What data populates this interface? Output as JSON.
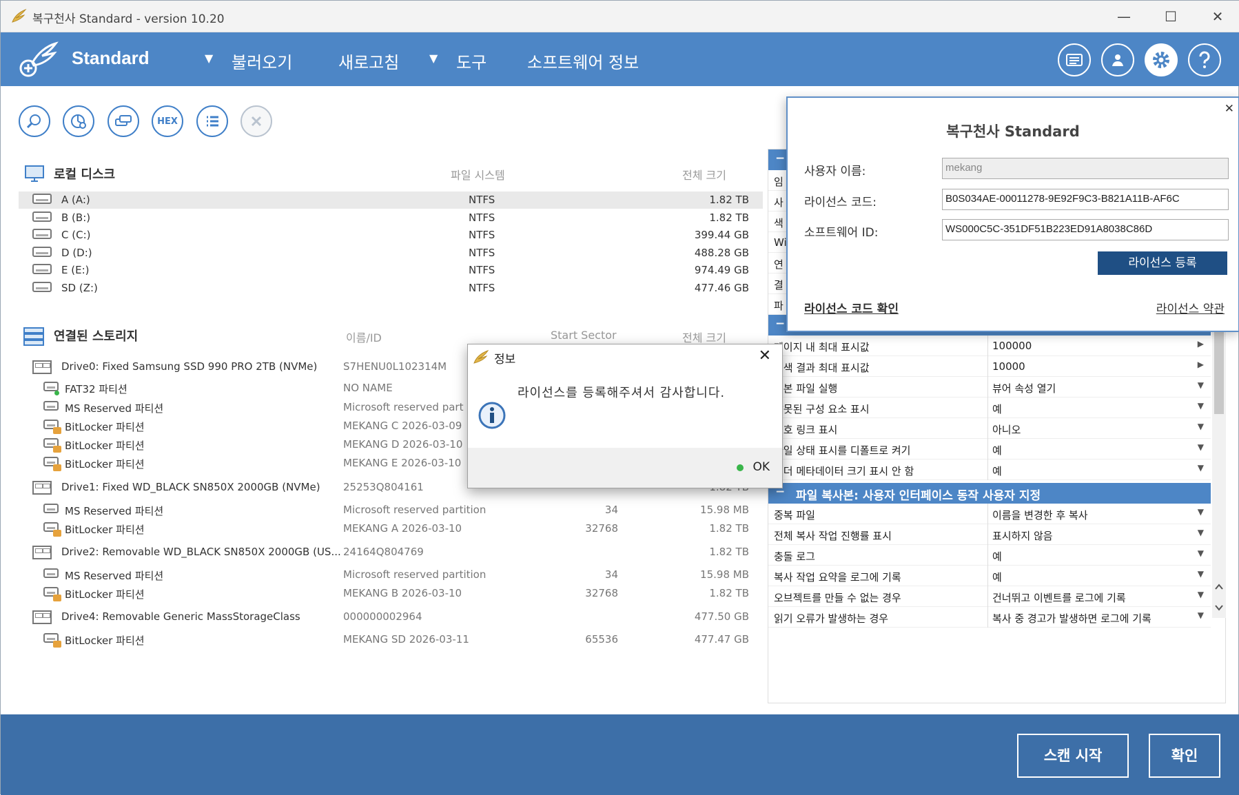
{
  "window": {
    "title": "복구천사 Standard - version 10.20",
    "minimize": "—",
    "maximize": "☐",
    "close": "✕"
  },
  "header": {
    "brand": "Standard",
    "menu": {
      "open": "불러오기",
      "refresh": "새로고침",
      "tools": "도구",
      "about": "소프트웨어 정보"
    },
    "caret": "▼"
  },
  "toolbar": {
    "hex_label": "HEX"
  },
  "local_disk": {
    "title": "로컬 디스크",
    "col_fs": "파일 시스템",
    "col_size": "전체 크기",
    "rows": [
      {
        "name": "A (A:)",
        "fs": "NTFS",
        "size": "1.82 TB"
      },
      {
        "name": "B (B:)",
        "fs": "NTFS",
        "size": "1.82 TB"
      },
      {
        "name": "C (C:)",
        "fs": "NTFS",
        "size": "399.44 GB"
      },
      {
        "name": "D (D:)",
        "fs": "NTFS",
        "size": "488.28 GB"
      },
      {
        "name": "E (E:)",
        "fs": "NTFS",
        "size": "974.49 GB"
      },
      {
        "name": "SD (Z:)",
        "fs": "NTFS",
        "size": "477.46 GB"
      }
    ]
  },
  "storage": {
    "title": "연결된 스토리지",
    "col_id": "이름/ID",
    "col_sector": "Start Sector",
    "col_size": "전체 크기",
    "rows": [
      {
        "name": "Drive0: Fixed Samsung SSD 990 PRO 2TB (NVMe)",
        "id": "S7HENU0L102314M",
        "sector": "",
        "size": ""
      },
      {
        "name": "FAT32 파티션",
        "id": "NO NAME",
        "sector": "",
        "size": ""
      },
      {
        "name": "MS Reserved 파티션",
        "id": "Microsoft reserved part",
        "sector": "",
        "size": ""
      },
      {
        "name": "BitLocker 파티션",
        "id": "MEKANG C 2026-03-09",
        "sector": "",
        "size": ""
      },
      {
        "name": "BitLocker 파티션",
        "id": "MEKANG D 2026-03-10",
        "sector": "",
        "size": ""
      },
      {
        "name": "BitLocker 파티션",
        "id": "MEKANG E 2026-03-10",
        "sector": "",
        "size": ""
      },
      {
        "name": "Drive1: Fixed WD_BLACK SN850X 2000GB (NVMe)",
        "id": "25253Q804161",
        "sector": "",
        "size": "1.82 TB"
      },
      {
        "name": "MS Reserved 파티션",
        "id": "Microsoft reserved partition",
        "sector": "34",
        "size": "15.98 MB"
      },
      {
        "name": "BitLocker 파티션",
        "id": "MEKANG A 2026-03-10",
        "sector": "32768",
        "size": "1.82 TB"
      },
      {
        "name": "Drive2: Removable WD_BLACK SN850X 2000GB (US...",
        "id": "24164Q804769",
        "sector": "",
        "size": "1.82 TB"
      },
      {
        "name": "MS Reserved 파티션",
        "id": "Microsoft reserved partition",
        "sector": "34",
        "size": "15.98 MB"
      },
      {
        "name": "BitLocker 파티션",
        "id": "MEKANG B 2026-03-10",
        "sector": "32768",
        "size": "1.82 TB"
      },
      {
        "name": "Drive4: Removable Generic MassStorageClass",
        "id": "000000002964",
        "sector": "",
        "size": "477.50 GB"
      },
      {
        "name": "BitLocker 파티션",
        "id": "MEKANG SD 2026-03-11",
        "sector": "65536",
        "size": "477.47 GB"
      }
    ]
  },
  "right_panel": {
    "top_rows": [
      "임",
      "사",
      "색",
      "Wi",
      "연",
      "결",
      "파"
    ],
    "dash": "−",
    "rows_a": [
      {
        "k": "페이지 내 최대 표시값",
        "v": "100000",
        "arrow": "▶"
      },
      {
        "k": "검색 결과 최대 표시값",
        "v": "10000",
        "arrow": "▶"
      },
      {
        "k": "원본 파일 실행",
        "v": "뷰어 속성 열기",
        "arrow": "▼"
      },
      {
        "k": "잘못된 구성 요소 표시",
        "v": "예",
        "arrow": "▼"
      },
      {
        "k": "기호 링크 표시",
        "v": "아니오",
        "arrow": "▼"
      },
      {
        "k": "파일 상태 표시를 디폴트로 켜기",
        "v": "예",
        "arrow": "▼"
      },
      {
        "k": "폴더 메타데이터 크기 표시 안 함",
        "v": "예",
        "arrow": "▼"
      }
    ],
    "section": "파일 복사본: 사용자 인터페이스 동작 사용자 지정",
    "rows_b": [
      {
        "k": "중복 파일",
        "v": "이름을 변경한 후 복사",
        "arrow": "▼"
      },
      {
        "k": "전체 복사 작업 진행률 표시",
        "v": "표시하지 않음",
        "arrow": "▼"
      },
      {
        "k": "충돌 로그",
        "v": "예",
        "arrow": "▼"
      },
      {
        "k": "복사 작업 요약을 로그에 기록",
        "v": "예",
        "arrow": "▼"
      },
      {
        "k": "오브젝트를 만들 수 없는 경우",
        "v": "건너뛰고 이벤트를 로그에 기록",
        "arrow": "▼"
      },
      {
        "k": "읽기 오류가 발생하는 경우",
        "v": "복사 중 경고가 발생하면 로그에 기록",
        "arrow": "▼"
      }
    ]
  },
  "license_popup": {
    "title": "복구천사 Standard",
    "close": "✕",
    "user_label": "사용자 이름:",
    "user_value": "mekang",
    "code_label": "라이선스 코드:",
    "code_value": "B0S034AE-00011278-9E92F9C3-B821A11B-AF6C",
    "swid_label": "소프트웨어 ID:",
    "swid_value": "WS000C5C-351DF51B223ED91A8038C86D",
    "register_button": "라이선스 등록",
    "check_link": "라이선스 코드 확인",
    "terms_link": "라이선스 약관"
  },
  "info_dialog": {
    "title": "정보",
    "message": "라이선스를 등록해주셔서 감사합니다.",
    "ok": "OK",
    "close": "✕"
  },
  "bottom": {
    "scan_button": "스캔 시작",
    "confirm_button": "확인"
  },
  "colors": {
    "header": "#4d86c6",
    "bottom": "#3d6fa8",
    "accent": "#3f7fc8",
    "register": "#1f4f84"
  }
}
